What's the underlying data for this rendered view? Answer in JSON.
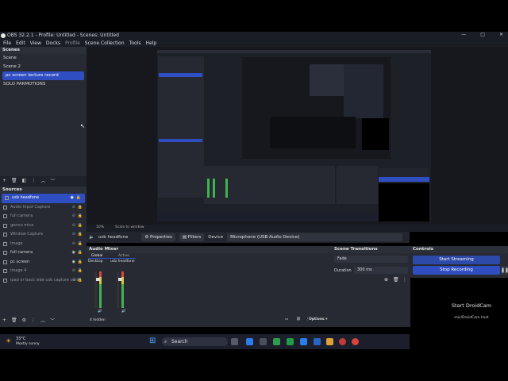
{
  "window": {
    "title": "OBS 32.2.1 - Profile: Untitled - Scenes: Untitled",
    "buttons": [
      "—",
      "□",
      "✕"
    ]
  },
  "menu": [
    "File",
    "Edit",
    "View",
    "Docks",
    "Profile",
    "Scene Collection",
    "Tools",
    "Help"
  ],
  "scenes": {
    "header": "Scenes",
    "items": [
      "Scene",
      "Scene 2",
      "pc screen lecture record",
      "SOLO PARMOTIONS"
    ],
    "selected_index": 2
  },
  "sources": {
    "header": "Sources",
    "items": [
      {
        "label": "usb headfone",
        "visible": true,
        "selected": true
      },
      {
        "label": "Audio Input Capture",
        "visible": false
      },
      {
        "label": "full camera",
        "visible": false
      },
      {
        "label": "genno mice",
        "visible": false
      },
      {
        "label": "Window Capture",
        "visible": false
      },
      {
        "label": "image",
        "visible": false
      },
      {
        "label": "full camera",
        "visible": true
      },
      {
        "label": "pc screen",
        "visible": true
      },
      {
        "label": "image 4",
        "visible": false
      },
      {
        "label": "ipad or back side usb capture card",
        "visible": false
      }
    ]
  },
  "context_bar": {
    "zoom": "10%",
    "fit": "Scale to window"
  },
  "property_bar": {
    "source_name": "usb headfone",
    "properties_label": "Properties",
    "filters_label": "Filters",
    "device_label": "Device",
    "device_value": "Microphone (USB Audio Device)"
  },
  "audio_mixer": {
    "header": "Audio Mixer",
    "tabs": [
      "Global",
      "Active"
    ],
    "channels": [
      "Desktop",
      "usb headfone"
    ],
    "status": "4 hidden",
    "options_label": "Options"
  },
  "transitions": {
    "header": "Scene Transitions",
    "type": "Fade",
    "duration_label": "Duration",
    "duration_value": "300 ms"
  },
  "controls": {
    "header": "Controls",
    "start_streaming": "Start Streaming",
    "stop_recording": "Stop Recording"
  },
  "taskbar": {
    "weather_temp": "33°C",
    "weather_desc": "Mostly sunny",
    "search_placeholder": "Search"
  },
  "droidcam": {
    "title": "Start DroidCam",
    "subtitle": "mic/DroidCam host"
  },
  "colors": {
    "accent": "#2f4ec2",
    "panel": "#272a33",
    "header": "#2b2f38"
  }
}
